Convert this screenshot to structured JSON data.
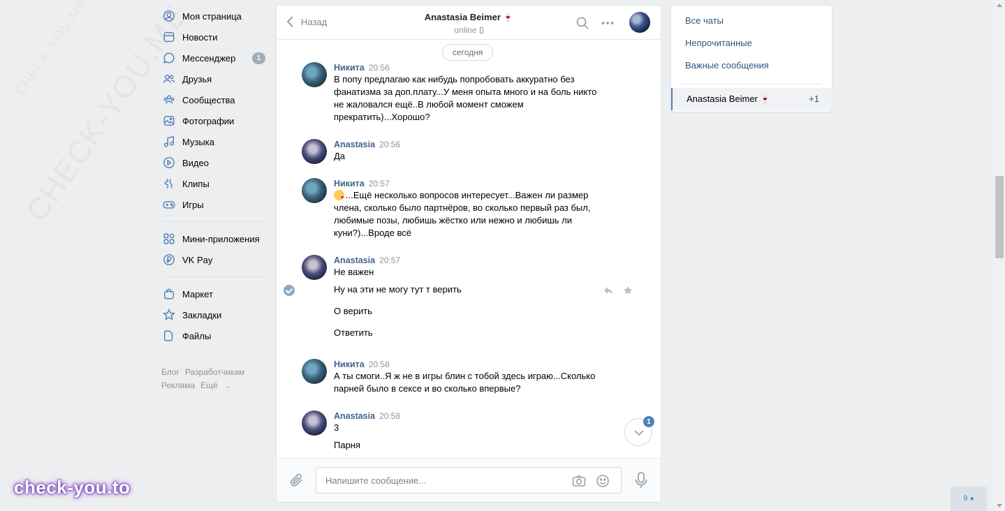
{
  "watermark": {
    "text": "CHECK-YOU.ME",
    "brand": "check-you.to"
  },
  "nav": {
    "items": [
      {
        "label": "Моя страница",
        "icon": "user-circle-icon"
      },
      {
        "label": "Новости",
        "icon": "news-icon"
      },
      {
        "label": "Мессенджер",
        "icon": "chat-bubble-icon",
        "count": "1"
      },
      {
        "label": "Друзья",
        "icon": "friends-icon"
      },
      {
        "label": "Сообщества",
        "icon": "communities-icon"
      },
      {
        "label": "Фотографии",
        "icon": "photo-icon"
      },
      {
        "label": "Музыка",
        "icon": "music-note-icon"
      },
      {
        "label": "Видео",
        "icon": "play-circle-icon"
      },
      {
        "label": "Клипы",
        "icon": "clips-icon"
      },
      {
        "label": "Игры",
        "icon": "gamepad-icon"
      }
    ],
    "apps": [
      {
        "label": "Мини-приложения",
        "icon": "grid-icon"
      },
      {
        "label": "VK Pay",
        "icon": "ruble-coin-icon"
      }
    ],
    "extra": [
      {
        "label": "Маркет",
        "icon": "shopping-bag-icon"
      },
      {
        "label": "Закладки",
        "icon": "star-icon"
      },
      {
        "label": "Файлы",
        "icon": "file-icon"
      }
    ],
    "footer": [
      "Блог",
      "Разработчикам",
      "Реклама",
      "Ещё"
    ]
  },
  "chat": {
    "back_label": "Назад",
    "peer_name": "Anastasia Beimer",
    "peer_emoji": "🍷",
    "peer_status": "online",
    "day": "сегодня",
    "messages": [
      {
        "author": "Никита",
        "time": "20:56",
        "lines": [
          "В попу предлагаю как нибудь попробовать аккуратно без",
          "фанатизма за доп.плату...У меня опыта много и на боль никто",
          "не жаловался ещё..В любой момент сможем",
          "прекратить)...Хорошо?"
        ]
      },
      {
        "author": "Anastasia",
        "time": "20:56",
        "lines": [
          "Да"
        ]
      },
      {
        "author": "Никита",
        "time": "20:57",
        "lines": [
          "...Ещё несколько вопросов интересует...Важен ли размер",
          "члена, сколько было партнёров, во сколько первый раз был,",
          "любимые позы, любишь жёстко или нежно и любишь ли",
          "куни?)...Вроде всё"
        ]
      },
      {
        "author": "Anastasia",
        "time": "20:57",
        "lines": [
          "Не важен"
        ]
      },
      {
        "author": "Никита",
        "time": "20:58",
        "lines": [
          "А ты смоги..Я ж не в игры блин с тобой здесь играю...Сколько",
          "парней было в сексе и во сколько впервые?"
        ]
      },
      {
        "author": "Anastasia",
        "time": "20:58",
        "lines": [
          "3"
        ]
      }
    ],
    "continuations": [
      "Ну на эти не могу тут т верить",
      "О верить",
      "Ответить",
      "Парня"
    ],
    "unread_badge": "1",
    "composer_placeholder": "Напишите сообщение..."
  },
  "side": {
    "filters": [
      "Все чаты",
      "Непрочитанные",
      "Важные сообщения"
    ],
    "chat_name": "Anastasia Beimer",
    "chat_emoji": "🍷",
    "chat_count": "+1"
  },
  "online_count": "9"
}
